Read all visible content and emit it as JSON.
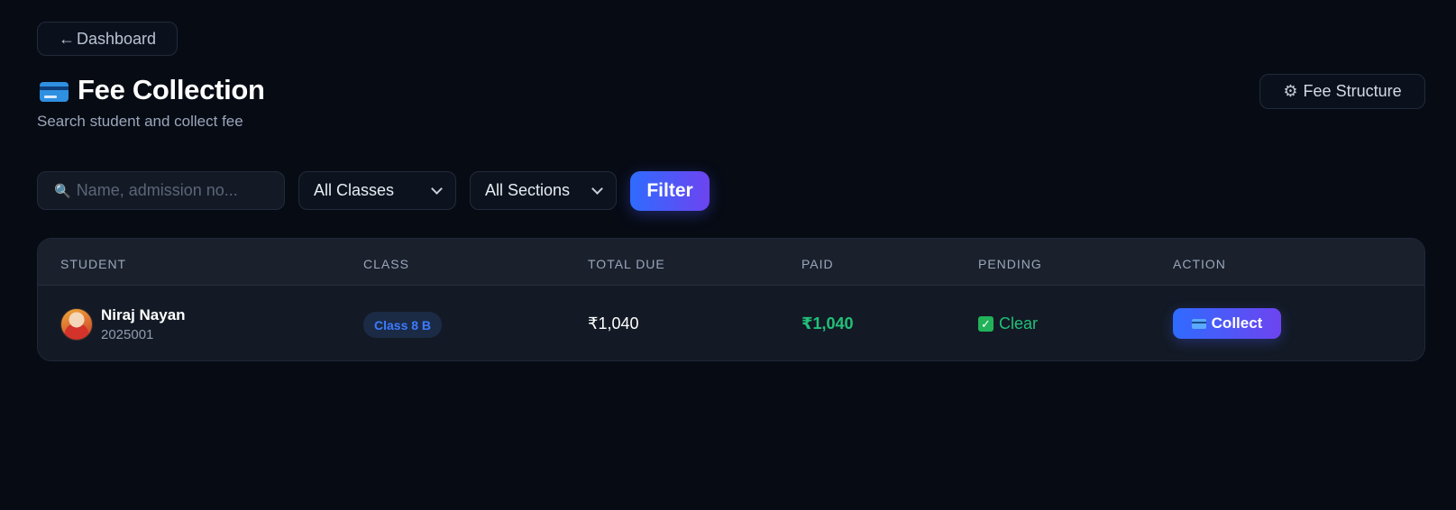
{
  "nav": {
    "back_arrow": "←",
    "back_label": "Dashboard"
  },
  "header": {
    "icon": "credit-card-icon",
    "title": "Fee Collection",
    "subtitle": "Search student and collect fee",
    "fee_structure_icon": "gear-icon",
    "fee_structure_label": "Fee Structure"
  },
  "filters": {
    "search_placeholder": "Name, admission no...",
    "search_value": "",
    "class_selected": "All Classes",
    "section_selected": "All Sections",
    "filter_label": "Filter"
  },
  "table": {
    "columns": [
      "STUDENT",
      "CLASS",
      "TOTAL DUE",
      "PAID",
      "PENDING",
      "ACTION"
    ],
    "rows": [
      {
        "name": "Niraj Nayan",
        "admission_no": "2025001",
        "class": "Class 8 B",
        "total_due": "₹1,040",
        "paid": "₹1,040",
        "pending": "Clear",
        "action": "Collect"
      }
    ]
  },
  "colors": {
    "background": "#070b14",
    "accent_gradient_start": "#2f6bff",
    "accent_gradient_end": "#6d44f0",
    "success": "#22c079",
    "badge_text": "#3d7bff"
  }
}
